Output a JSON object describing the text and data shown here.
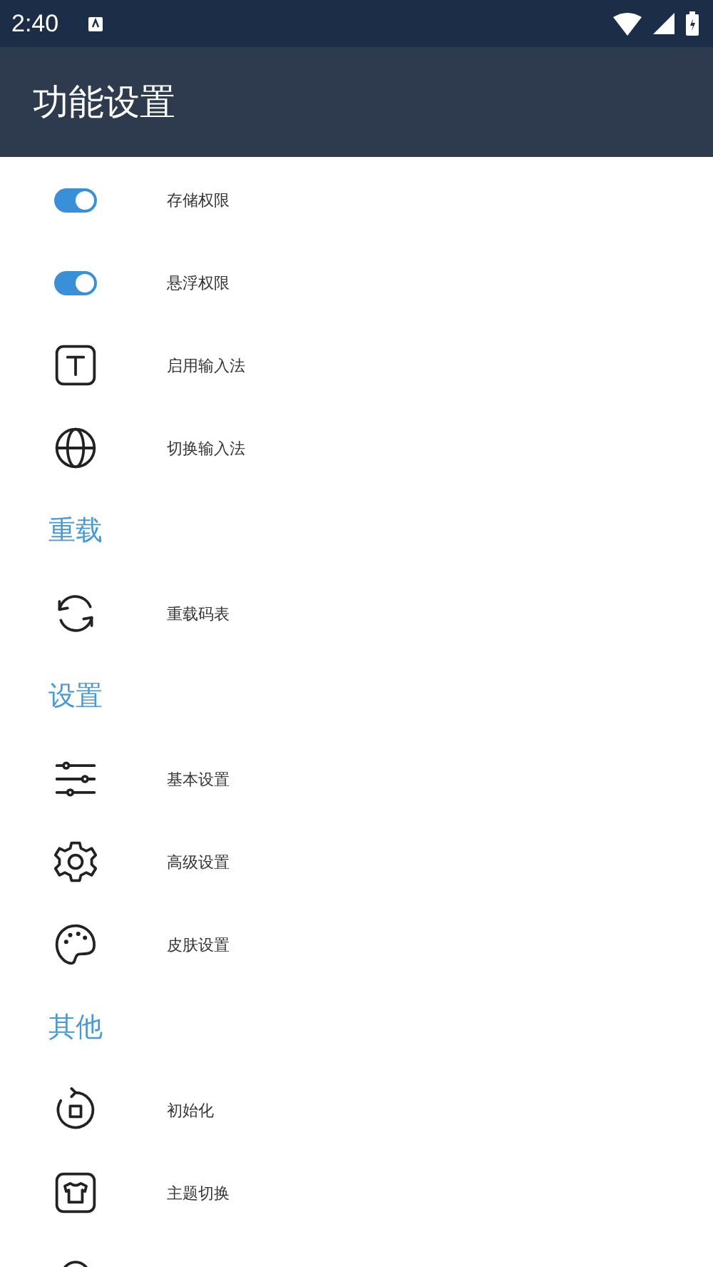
{
  "status_bar": {
    "time": "2:40"
  },
  "app_bar": {
    "title": "功能设置"
  },
  "list": [
    {
      "kind": "switch",
      "label": "存储权限",
      "on": true
    },
    {
      "kind": "switch",
      "label": "悬浮权限",
      "on": true
    },
    {
      "kind": "item",
      "label": "启用输入法"
    },
    {
      "kind": "item",
      "label": "切换输入法"
    },
    {
      "kind": "header",
      "label": "重载"
    },
    {
      "kind": "item",
      "label": "重载码表"
    },
    {
      "kind": "header",
      "label": "设置"
    },
    {
      "kind": "item",
      "label": "基本设置"
    },
    {
      "kind": "item",
      "label": "高级设置"
    },
    {
      "kind": "item",
      "label": "皮肤设置"
    },
    {
      "kind": "header",
      "label": "其他"
    },
    {
      "kind": "item",
      "label": "初始化"
    },
    {
      "kind": "item",
      "label": "主题切换"
    },
    {
      "kind": "item"
    }
  ]
}
